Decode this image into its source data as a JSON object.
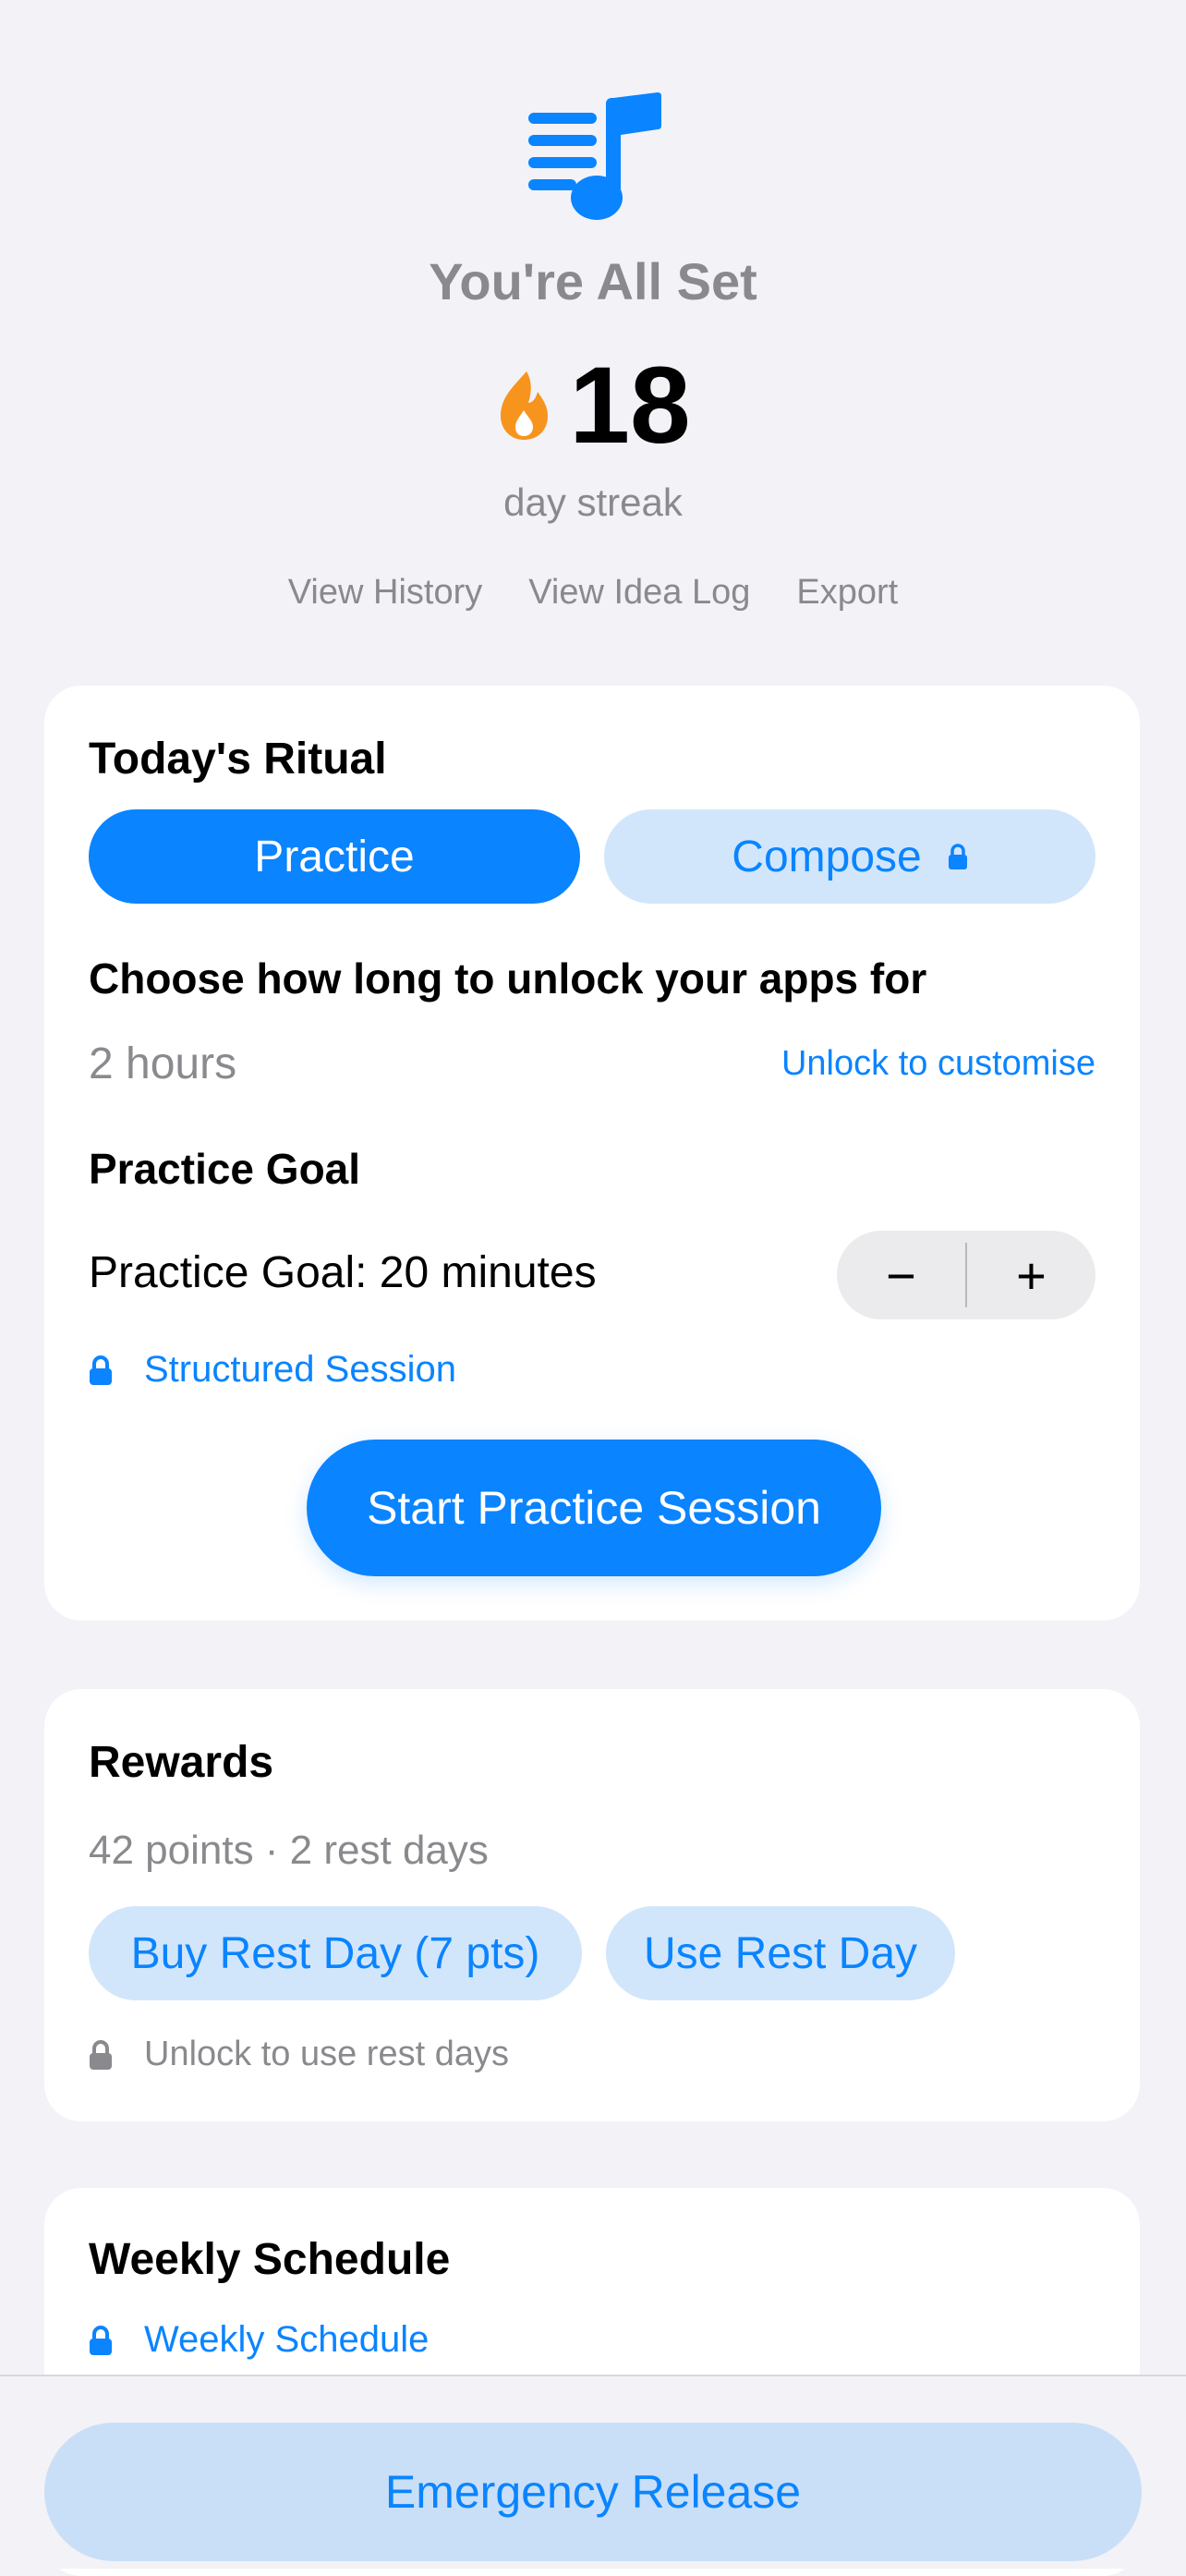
{
  "header": {
    "title": "You're All Set",
    "streak_count": "18",
    "streak_label": "day streak",
    "links": [
      "View History",
      "View Idea Log",
      "Export"
    ]
  },
  "ritual": {
    "heading": "Today's Ritual",
    "tabs": [
      {
        "label": "Practice",
        "selected": true
      },
      {
        "label": "Compose",
        "selected": false,
        "locked": true
      }
    ],
    "unlock_title": "Choose how long to unlock your apps for",
    "duration_value": "2 hours",
    "customise_link": "Unlock to customise",
    "goal_title": "Practice Goal",
    "goal_text": "Practice Goal: 20 minutes",
    "stepper": {
      "minus": "−",
      "plus": "+"
    },
    "structured_session": "Structured Session",
    "start_button": "Start Practice Session"
  },
  "rewards": {
    "heading": "Rewards",
    "meta": "42 points · 2 rest days",
    "buy_button": "Buy Rest Day (7 pts)",
    "use_button": "Use Rest Day",
    "locked_note": "Unlock to use rest days"
  },
  "weekly": {
    "heading": "Weekly Schedule",
    "locked_link": "Weekly Schedule"
  },
  "footer": {
    "emergency_button": "Emergency Release"
  },
  "colors": {
    "accent": "#0A84FF",
    "accent_soft": "#D2E6FB",
    "background": "#F2F2F7",
    "secondary_text": "#8A8A8E",
    "flame": "#F7941D"
  }
}
